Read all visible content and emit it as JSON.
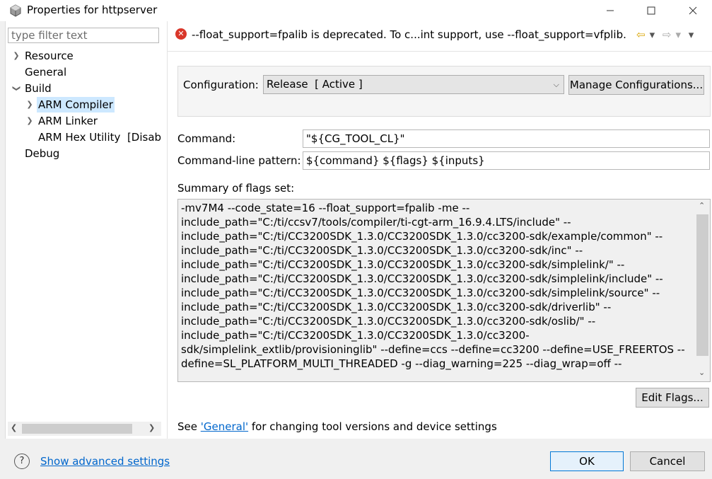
{
  "window": {
    "title": "Properties for httpserver",
    "minimize_icon": "minimize-icon",
    "maximize_icon": "maximize-icon",
    "close_icon": "close-icon"
  },
  "filter": {
    "placeholder": "type filter text"
  },
  "tree": {
    "resource": "Resource",
    "general": "General",
    "build": "Build",
    "arm_compiler": "ARM Compiler",
    "arm_linker": "ARM Linker",
    "arm_hex": "ARM Hex Utility  [Disabl",
    "debug": "Debug"
  },
  "header": {
    "message": "--float_support=fpalib is deprecated. To c...int support, use --float_support=vfplib.",
    "status": "error"
  },
  "config": {
    "label": "Configuration:",
    "value": "Release  [ Active ]",
    "manage_button": "Manage Configurations..."
  },
  "command": {
    "label": "Command:",
    "value": "\"${CG_TOOL_CL}\""
  },
  "pattern": {
    "label": "Command-line pattern:",
    "value": "${command} ${flags} ${inputs}"
  },
  "summary": {
    "label": "Summary of flags set:",
    "lines": [
      "-mv7M4 --code_state=16 --float_support=fpalib -me --",
      "include_path=\"C:/ti/ccsv7/tools/compiler/ti-cgt-arm_16.9.4.LTS/include\" --",
      "include_path=\"C:/ti/CC3200SDK_1.3.0/CC3200SDK_1.3.0/cc3200-sdk/example/common\" --",
      "include_path=\"C:/ti/CC3200SDK_1.3.0/CC3200SDK_1.3.0/cc3200-sdk/inc\" --",
      "include_path=\"C:/ti/CC3200SDK_1.3.0/CC3200SDK_1.3.0/cc3200-sdk/simplelink/\" --",
      "include_path=\"C:/ti/CC3200SDK_1.3.0/CC3200SDK_1.3.0/cc3200-sdk/simplelink/include\" --",
      "include_path=\"C:/ti/CC3200SDK_1.3.0/CC3200SDK_1.3.0/cc3200-sdk/simplelink/source\" --",
      "include_path=\"C:/ti/CC3200SDK_1.3.0/CC3200SDK_1.3.0/cc3200-sdk/driverlib\" --",
      "include_path=\"C:/ti/CC3200SDK_1.3.0/CC3200SDK_1.3.0/cc3200-sdk/oslib/\" --",
      "include_path=\"C:/ti/CC3200SDK_1.3.0/CC3200SDK_1.3.0/cc3200-",
      "sdk/simplelink_extlib/provisioninglib\" --define=ccs --define=cc3200 --define=USE_FREERTOS --",
      "define=SL_PLATFORM_MULTI_THREADED -g --diag_warning=225 --diag_wrap=off --"
    ]
  },
  "edit_flags_button": "Edit Flags...",
  "footer_note": {
    "prefix": "See ",
    "link": "'General'",
    "suffix": " for changing tool versions and device settings"
  },
  "bottom": {
    "advanced_link": "Show advanced settings",
    "ok": "OK",
    "cancel": "Cancel"
  }
}
